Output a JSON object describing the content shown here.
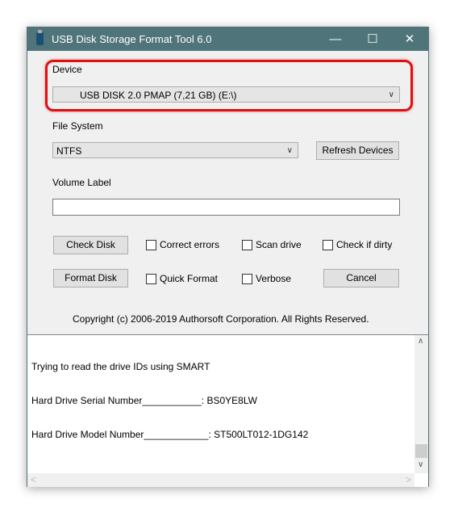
{
  "window": {
    "title": "USB Disk Storage Format Tool 6.0",
    "controls": {
      "minimize": "—",
      "maximize": "☐",
      "close": "✕"
    }
  },
  "device": {
    "label": "Device",
    "value": "USB DISK 2.0  PMAP (7,21 GB) (E:\\)"
  },
  "file_system": {
    "label": "File System",
    "value": "NTFS",
    "refresh_button": "Refresh Devices"
  },
  "volume_label": {
    "label": "Volume Label",
    "value": ""
  },
  "actions": {
    "check_disk": "Check Disk",
    "format_disk": "Format Disk",
    "cancel": "Cancel"
  },
  "options": {
    "correct_errors": "Correct errors",
    "scan_drive": "Scan drive",
    "check_if_dirty": "Check if dirty",
    "quick_format": "Quick Format",
    "verbose": "Verbose"
  },
  "copyright": "Copyright (c) 2006-2019 Authorsoft Corporation. All Rights Reserved.",
  "log": [
    "Trying to read the drive IDs using SMART",
    "Hard Drive Serial Number___________: BS0YE8LW",
    "Hard Drive Model Number____________: ST500LT012-1DG142"
  ],
  "highlight_color": "#e01010"
}
